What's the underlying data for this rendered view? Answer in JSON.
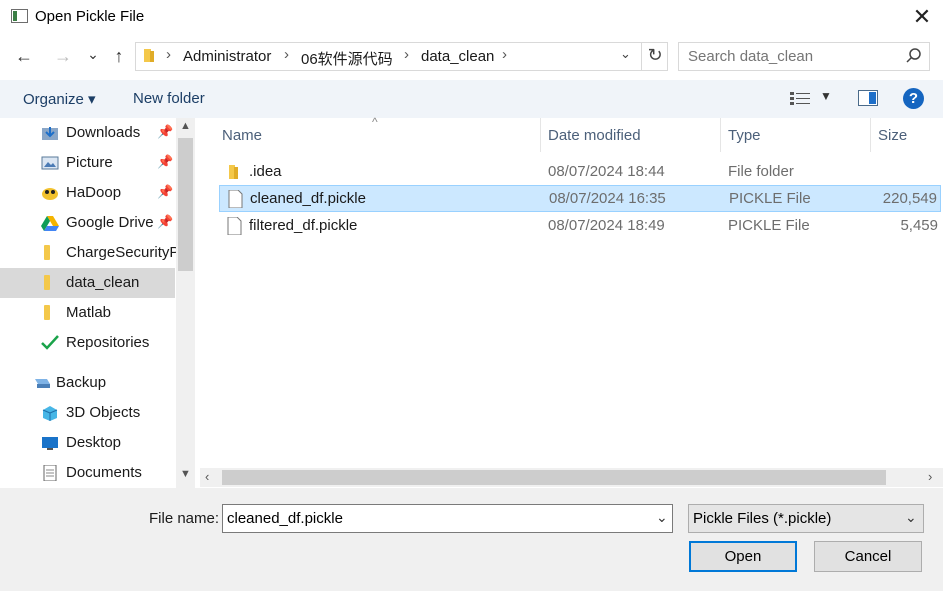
{
  "window": {
    "title": "Open Pickle File",
    "close_glyph": "✕"
  },
  "nav": {
    "back_glyph": "←",
    "forward_glyph": "→",
    "recent_glyph": "⌄",
    "up_glyph": "↑",
    "breadcrumbs": [
      "Administrator",
      "06软件源代码",
      "data_clean"
    ],
    "refresh_glyph": "↻",
    "search_placeholder": "Search data_clean"
  },
  "toolbar": {
    "organize_label": "Organize ▾",
    "new_folder_label": "New folder",
    "help_label": "?"
  },
  "sidebar": {
    "items": [
      {
        "label": "Downloads",
        "icon": "downloads-icon",
        "pinned": true,
        "selected": false
      },
      {
        "label": "Picture",
        "icon": "picture-icon",
        "pinned": true,
        "selected": false
      },
      {
        "label": "HaDoop",
        "icon": "hadoop-icon",
        "pinned": true,
        "selected": false
      },
      {
        "label": "Google Drive",
        "icon": "google-drive-icon",
        "pinned": true,
        "selected": false
      },
      {
        "label": "ChargeSecurityPr",
        "icon": "folder-icon",
        "pinned": false,
        "selected": false
      },
      {
        "label": "data_clean",
        "icon": "folder-icon",
        "pinned": false,
        "selected": true
      },
      {
        "label": "Matlab",
        "icon": "folder-icon",
        "pinned": false,
        "selected": false
      },
      {
        "label": "Repositories",
        "icon": "checkmark-icon",
        "pinned": false,
        "selected": false
      },
      {
        "label": "Backup",
        "icon": "backup-drive-icon",
        "pinned": false,
        "selected": false
      },
      {
        "label": "3D Objects",
        "icon": "3d-objects-icon",
        "pinned": false,
        "selected": false
      },
      {
        "label": "Desktop",
        "icon": "desktop-icon",
        "pinned": false,
        "selected": false
      },
      {
        "label": "Documents",
        "icon": "documents-icon",
        "pinned": false,
        "selected": false
      }
    ],
    "pin_glyph": "📌"
  },
  "files": {
    "columns": {
      "name": "Name",
      "date": "Date modified",
      "type": "Type",
      "size": "Size"
    },
    "rows": [
      {
        "name": ".idea",
        "date": "08/07/2024 18:44",
        "type": "File folder",
        "size": "",
        "icon": "folder-icon",
        "selected": false
      },
      {
        "name": "cleaned_df.pickle",
        "date": "08/07/2024 16:35",
        "type": "PICKLE File",
        "size": "220,549",
        "icon": "file-icon",
        "selected": true
      },
      {
        "name": "filtered_df.pickle",
        "date": "08/07/2024 18:49",
        "type": "PICKLE File",
        "size": "5,459",
        "icon": "file-icon",
        "selected": false
      }
    ]
  },
  "footer": {
    "filename_label": "File name:",
    "filename_value": "cleaned_df.pickle",
    "filter_value": "Pickle Files (*.pickle)",
    "open_label": "Open",
    "cancel_label": "Cancel"
  },
  "colors": {
    "selection": "#cce8ff",
    "accent": "#0078d7",
    "folder": "#f4c84a"
  }
}
